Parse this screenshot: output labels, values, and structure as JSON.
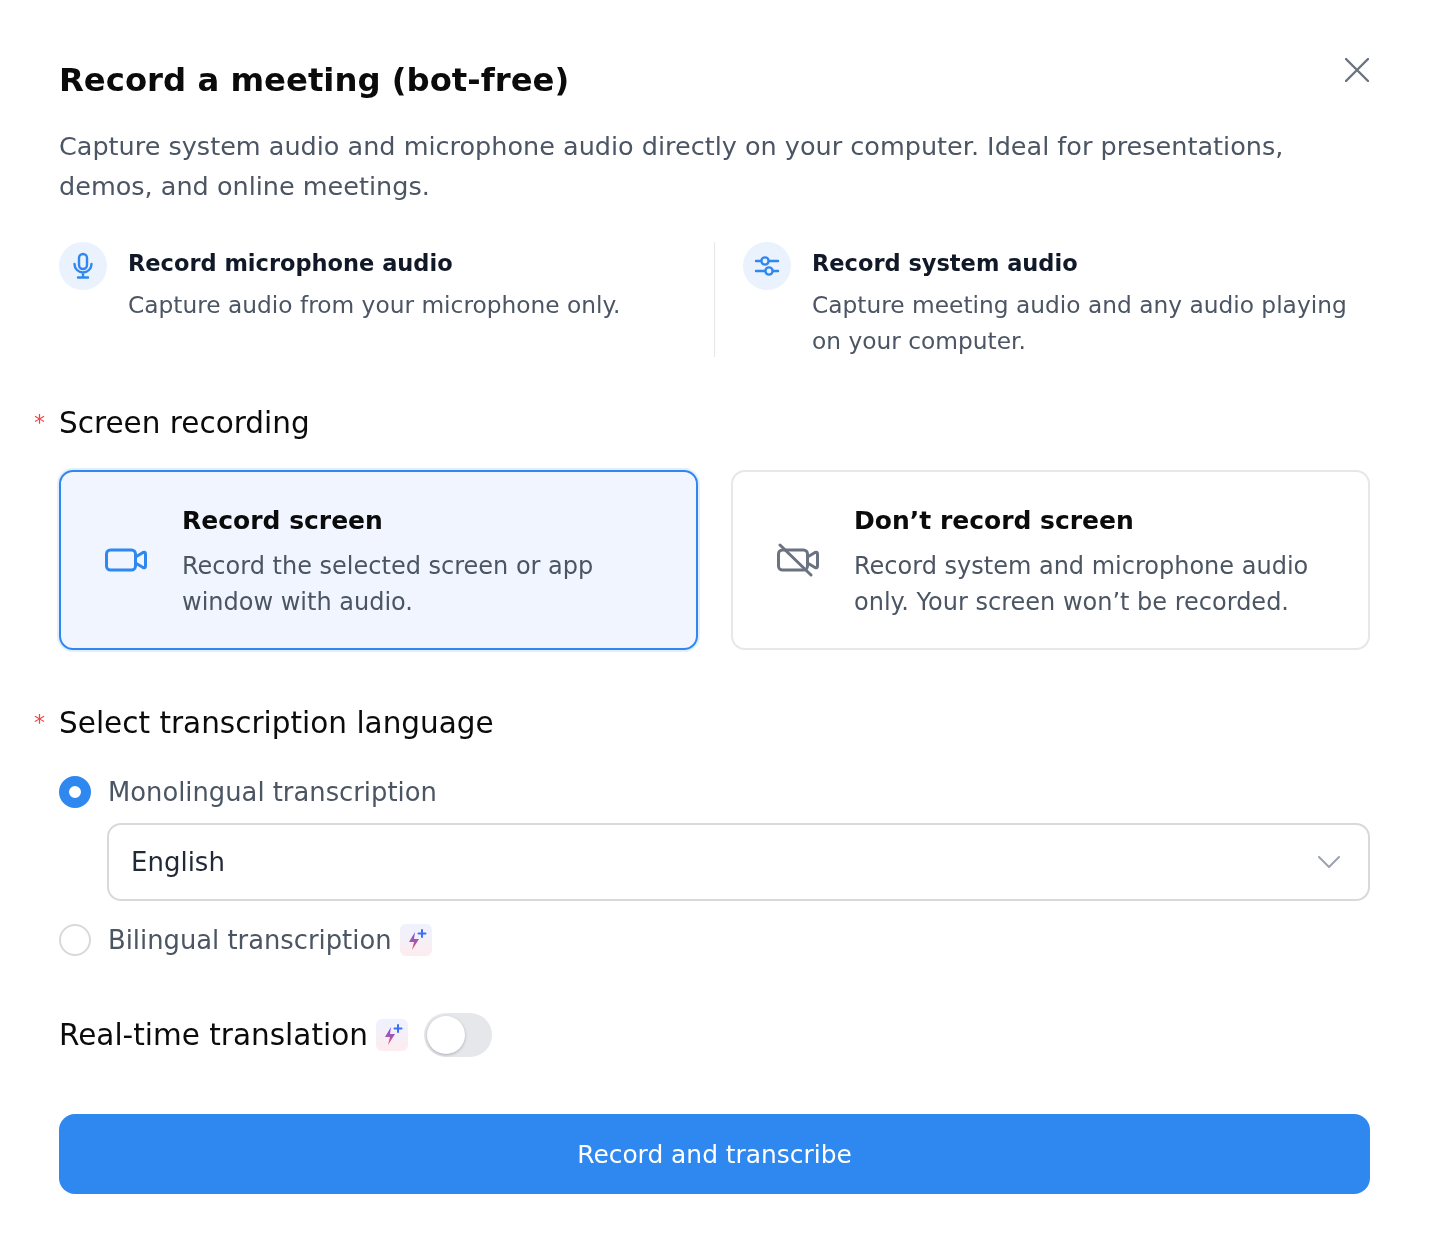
{
  "dialog": {
    "title": "Record a meeting (bot-free)",
    "description": "Capture system audio and microphone audio directly on your computer. Ideal for presentations, demos, and online meetings."
  },
  "audio_sources": [
    {
      "kind": "microphone",
      "title": "Record microphone audio",
      "description": "Capture audio from your microphone only."
    },
    {
      "kind": "system",
      "title": "Record system audio",
      "description": "Capture meeting audio and any audio playing on your computer."
    }
  ],
  "screen_recording": {
    "required_mark": "*",
    "label": "Screen recording",
    "options": [
      {
        "kind": "record",
        "title": "Record screen",
        "description": "Record the selected screen or app window with audio.",
        "selected": true
      },
      {
        "kind": "no_record",
        "title": "Don’t record screen",
        "description": "Record system and microphone audio only. Your screen won’t be recorded.",
        "selected": false
      }
    ]
  },
  "transcription_language": {
    "required_mark": "*",
    "label": "Select transcription language",
    "options": [
      {
        "label": "Monolingual transcription",
        "selected": true,
        "ai": false,
        "select": {
          "value": "English"
        }
      },
      {
        "label": "Bilingual transcription",
        "selected": false,
        "ai": true
      }
    ]
  },
  "realtime_translation": {
    "label": "Real-time translation",
    "ai": true,
    "on": false
  },
  "primary_button": "Record and transcribe"
}
